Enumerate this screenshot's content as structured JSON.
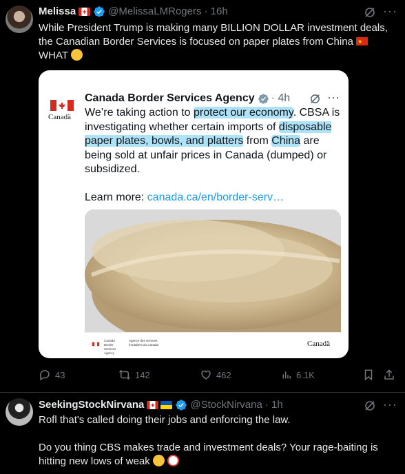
{
  "tweet1": {
    "name": "Melissa",
    "handle": "@MelissaLMRogers",
    "time": "· 16h",
    "line1": "While President Trump is making many BILLION DOLLAR investment deals,",
    "line2": "the Canadian Border Services is focused on paper plates from China",
    "line3": "WHAT",
    "more_icon": "more-icon",
    "grok_icon": "grok-icon"
  },
  "card": {
    "org_logo_word": "Canadä",
    "name": "Canada Border Services Agency",
    "time": "· 4h",
    "text_a": "We’re taking action to ",
    "text_hl1": "protect our economy",
    "text_b": ". CBSA is investigating whether certain imports of ",
    "text_hl2": "disposable paper plates, bowls, and platters",
    "text_c": " from ",
    "text_hl3": "China",
    "text_d": " are being sold at unfair prices in Canada (dumped) or subsidized.",
    "learn_label": "Learn more: ",
    "learn_link": "canada.ca/en/border-serv…",
    "foot_agency_en": "Canada Border Services Agency",
    "foot_agency_fr": "Agence des services frontaliers du Canada",
    "foot_word": "Canadä"
  },
  "actions": {
    "replies": "43",
    "reposts": "142",
    "likes": "462",
    "views": "6.1K"
  },
  "tweet2": {
    "name": "SeekingStockNirvana",
    "handle": "@StockNirvana",
    "time": "· 1h",
    "line1": "Rofl that's called doing their jobs and enforcing the law.",
    "line2": "Do you thing CBS makes trade and investment deals? Your rage-baiting is",
    "line3": "hitting new lows of weak"
  },
  "colors": {
    "background": "#000000",
    "text": "#e7e9ea",
    "muted": "#71767b",
    "verified": "#1d9bf0",
    "highlight": "#aee3f7"
  }
}
